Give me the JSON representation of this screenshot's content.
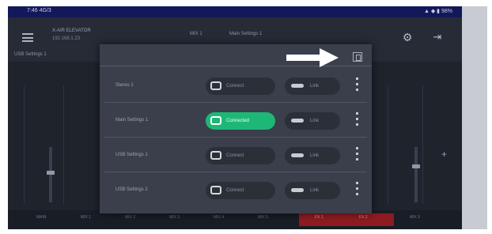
{
  "statusbar": {
    "left_text": "7:46 4G/3",
    "right_text": "▲ ◆ ▮ 98%"
  },
  "header": {
    "device_name": "X-AIR ELEVATOR",
    "device_ip": "192.168.1.23",
    "mix_label": "MIX 1",
    "mix_value": "Main Settings 1",
    "sub_label": "USB Settings 1"
  },
  "bottom_tabs": [
    "MAIN",
    "MIX 1",
    "MIX 2",
    "MIX 3",
    "MIX 4",
    "MIX 5",
    "FX 1",
    "FX 2",
    "MIX 9"
  ],
  "modal": {
    "rows": [
      {
        "name": "Stereo 1",
        "connect_label": "Connect",
        "link_label": "Link",
        "active": false
      },
      {
        "name": "Main Settings 1",
        "connect_label": "Connected",
        "link_label": "Link",
        "active": true
      },
      {
        "name": "USB Settings 1",
        "connect_label": "Connect",
        "link_label": "Link",
        "active": false
      },
      {
        "name": "USB Settings 2",
        "connect_label": "Connect",
        "link_label": "Link",
        "active": false
      }
    ]
  },
  "colors": {
    "accent_green": "#1db877",
    "arrow": "#ffffff",
    "status_bar": "#13185a",
    "record_red": "#8e1b22"
  },
  "icons": [
    "menu-icon",
    "gear-icon",
    "exit-icon",
    "close-icon",
    "tablet-icon",
    "link-icon",
    "kebab-icon",
    "plus-icon",
    "arrow-icon"
  ]
}
